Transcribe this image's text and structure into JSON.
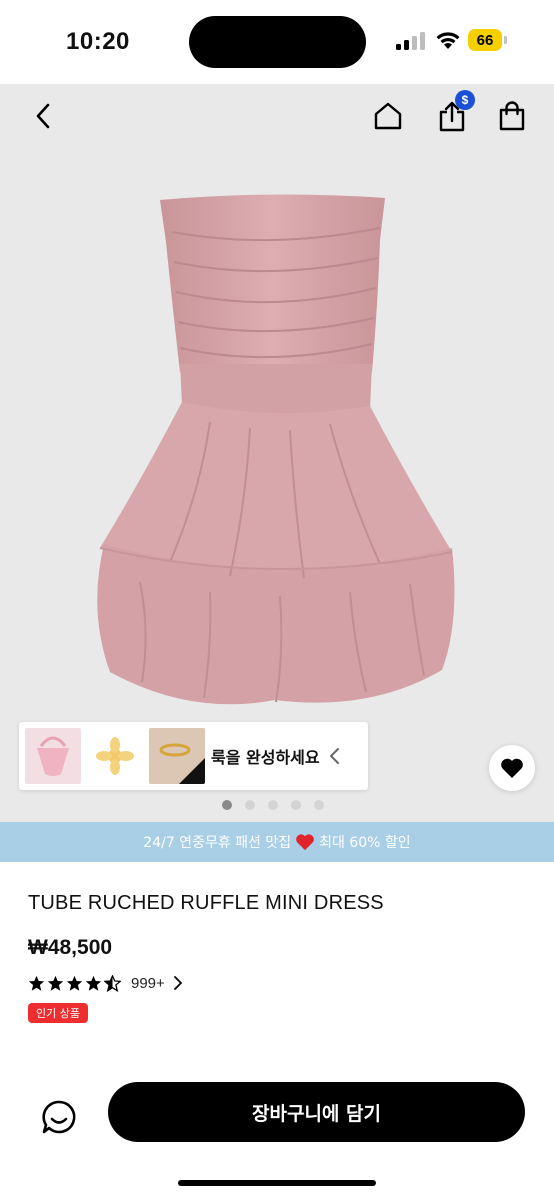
{
  "status_bar": {
    "time": "10:20",
    "battery": "66"
  },
  "nav": {
    "back_icon": "chevron-left-icon",
    "home_icon": "home-icon",
    "share_icon": "share-icon",
    "share_badge": "$",
    "bag_icon": "shopping-bag-icon"
  },
  "gallery": {
    "complete_look_label": "룩을 완성하세요",
    "thumbnails": [
      "pink-bag",
      "gold-flower-hairclip",
      "gold-arm-cuff"
    ],
    "dot_count": 5,
    "active_dot": 0,
    "wishlist_icon": "heart-icon"
  },
  "promo": {
    "text_before": "24/7 연중무휴 패션 맛집",
    "text_after": "최대 60% 할인",
    "heart_color": "#e0242c"
  },
  "product": {
    "title": "TUBE RUCHED RUFFLE MINI DRESS",
    "price": "₩48,500",
    "rating": 4.5,
    "review_count": "999+",
    "badge": "인기 상품",
    "badge_color": "#ee2e2e"
  },
  "bottom_bar": {
    "chat_icon": "chat-icon",
    "add_to_cart_label": "장바구니에 담기"
  },
  "colors": {
    "image_background": "#e9e9e9",
    "banner": "#a9cfe6",
    "dress": "#d9a9ad",
    "share_badge": "#1a4fd6",
    "cart_button": "#000000"
  }
}
